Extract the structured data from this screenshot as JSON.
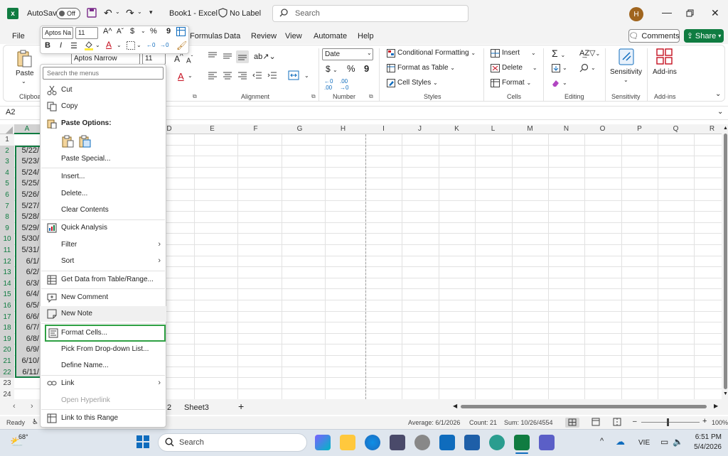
{
  "titlebar": {
    "autosave_label": "AutoSave",
    "autosave_state": "Off",
    "filename": "Book1",
    "app_sep": "-",
    "app": "Excel",
    "label": "No Label",
    "search_placeholder": "Search",
    "avatar_initial": "H"
  },
  "tabs": [
    "File",
    "Formulas",
    "Data",
    "Review",
    "View",
    "Automate",
    "Help"
  ],
  "comments_label": "Comments",
  "share_label": "Share",
  "ribbon": {
    "clipboard_label": "Clipboa",
    "paste_label": "Paste",
    "font_name": "Aptos Narrow",
    "font_size": "11",
    "alignment_label": "Alignment",
    "number_format": "Date",
    "number_label": "Number",
    "conditional_formatting": "Conditional Formatting",
    "format_as_table": "Format as Table",
    "cell_styles": "Cell Styles",
    "styles_label": "Styles",
    "insert": "Insert",
    "delete": "Delete",
    "format": "Format",
    "cells_label": "Cells",
    "editing_label": "Editing",
    "sensitivity": "Sensitivity",
    "addins": "Add-ins",
    "sensitivity_group": "Sensitivity",
    "addins_group": "Add-ins"
  },
  "namebox": "A2",
  "columns": [
    "A",
    "D",
    "E",
    "F",
    "G",
    "H",
    "I",
    "J",
    "K",
    "L",
    "M",
    "N",
    "O",
    "P",
    "Q",
    "R"
  ],
  "rows": [
    "1",
    "2",
    "3",
    "4",
    "5",
    "6",
    "7",
    "8",
    "9",
    "10",
    "11",
    "12",
    "13",
    "14",
    "15",
    "16",
    "17",
    "18",
    "19",
    "20",
    "21",
    "22",
    "23",
    "24"
  ],
  "cells_a": [
    "",
    "5/22/",
    "5/23/",
    "5/24/",
    "5/25/",
    "5/26/",
    "5/27/",
    "5/28/",
    "5/29/",
    "5/30/",
    "5/31/",
    "6/1/",
    "6/2/",
    "6/3/",
    "6/4/",
    "6/5/",
    "6/6/",
    "6/7/",
    "6/8/",
    "6/9/",
    "6/10/",
    "6/11/"
  ],
  "mini_toolbar": {
    "font_name": "Aptos Na",
    "font_size": "11"
  },
  "context_menu": {
    "search_placeholder": "Search the menus",
    "items": [
      {
        "label": "Cut"
      },
      {
        "label": "Copy"
      },
      {
        "label": "Paste Options:"
      },
      {
        "label": "Paste Special..."
      },
      {
        "label": "Insert..."
      },
      {
        "label": "Delete..."
      },
      {
        "label": "Clear Contents"
      },
      {
        "label": "Quick Analysis"
      },
      {
        "label": "Filter"
      },
      {
        "label": "Sort"
      },
      {
        "label": "Get Data from Table/Range..."
      },
      {
        "label": "New Comment"
      },
      {
        "label": "New Note"
      },
      {
        "label": "Format Cells..."
      },
      {
        "label": "Pick From Drop-down List..."
      },
      {
        "label": "Define Name..."
      },
      {
        "label": "Link"
      },
      {
        "label": "Open Hyperlink"
      },
      {
        "label": "Link to this Range"
      }
    ]
  },
  "sheets": {
    "partial": "2",
    "sheet3": "Sheet3",
    "add": "+"
  },
  "status": {
    "ready": "Ready",
    "average": "Average: 6/1/2026",
    "count": "Count: 21",
    "sum": "Sum: 10/26/4554",
    "zoom": "100%"
  },
  "taskbar": {
    "weather_temp": "68°",
    "search_placeholder": "Search",
    "lang": "VIE",
    "time": "6:51 PM",
    "date": "5/4/2026"
  },
  "colors": {
    "excel_green": "#107c41",
    "highlight_border": "#2ea043"
  }
}
